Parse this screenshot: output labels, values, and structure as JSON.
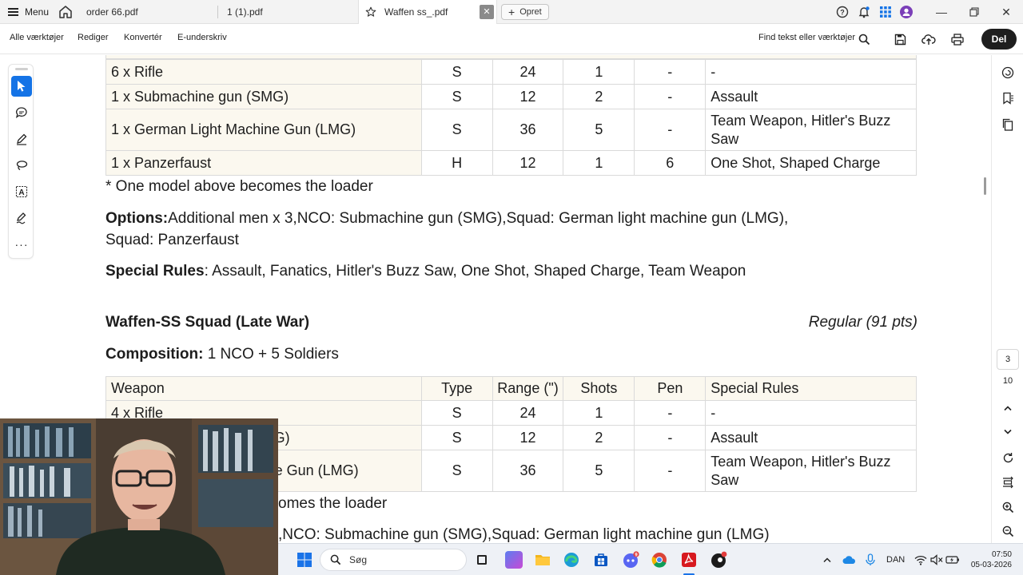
{
  "tabbar": {
    "menu_label": "Menu",
    "tabs": [
      {
        "label": "order 66.pdf"
      },
      {
        "label": "1 (1).pdf"
      },
      {
        "label": "Waffen ss_.pdf"
      }
    ],
    "new_tab_label": "Opret"
  },
  "toolbar": {
    "items": [
      "Alle værktøjer",
      "Rediger",
      "Konvertér",
      "E-underskriv"
    ],
    "find_label": "Find tekst eller værktøjer",
    "share_label": "Del"
  },
  "document": {
    "table1_rows": [
      {
        "weapon": "6 x Rifle",
        "type": "S",
        "range": "24",
        "shots": "1",
        "pen": "-",
        "special": "-"
      },
      {
        "weapon": "1 x Submachine gun (SMG)",
        "type": "S",
        "range": "12",
        "shots": "2",
        "pen": "-",
        "special": "Assault"
      },
      {
        "weapon": "1 x German Light Machine Gun (LMG)",
        "type": "S",
        "range": "36",
        "shots": "5",
        "pen": "-",
        "special": "Team Weapon, Hitler's Buzz Saw"
      },
      {
        "weapon": "1 x Panzerfaust",
        "type": "H",
        "range": "12",
        "shots": "1",
        "pen": "6",
        "special": "One Shot, Shaped Charge"
      }
    ],
    "loader_note": "* One model above becomes the loader",
    "options_label": "Options:",
    "options_text_line1": "Additional men x 3,NCO: Submachine gun (SMG),Squad: German light machine gun (LMG),",
    "options_text_line2": "Squad: Panzerfaust",
    "special_rules_label": "Special Rules",
    "special_rules_text": ": Assault, Fanatics, Hitler's Buzz Saw, One Shot, Shaped Charge, Team Weapon",
    "unit2_title": "Waffen-SS Squad (Late War)",
    "unit2_cost": "Regular (91 pts)",
    "composition_label": "Composition:",
    "composition_text": " 1 NCO + 5 Soldiers",
    "table2_headers": {
      "weapon": "Weapon",
      "type": "Type",
      "range": "Range (\")",
      "shots": "Shots",
      "pen": "Pen",
      "special": "Special Rules"
    },
    "table2_rows": [
      {
        "weapon": "4 x Rifle",
        "type": "S",
        "range": "24",
        "shots": "1",
        "pen": "-",
        "special": "-"
      },
      {
        "weapon": "G)",
        "type": "S",
        "range": "12",
        "shots": "2",
        "pen": "-",
        "special": "Assault"
      },
      {
        "weapon": "e Gun (LMG)",
        "type": "S",
        "range": "36",
        "shots": "5",
        "pen": "-",
        "special": "Team Weapon, Hitler's Buzz Saw"
      }
    ],
    "loader_note2_partial": "omes the loader",
    "options2_partial": ",NCO: Submachine gun (SMG),Squad: German light machine gun (LMG)"
  },
  "rightrail": {
    "current_page": "3",
    "total_pages": "10"
  },
  "taskbar": {
    "search_placeholder": "Søg",
    "language": "DAN",
    "time": "07:50",
    "date": "05-03-2026"
  },
  "colors": {
    "accent": "#1473e6",
    "table_shade": "#fbf8ef",
    "share_button": "#1e1e1e",
    "acrobat_red": "#d7191f"
  }
}
